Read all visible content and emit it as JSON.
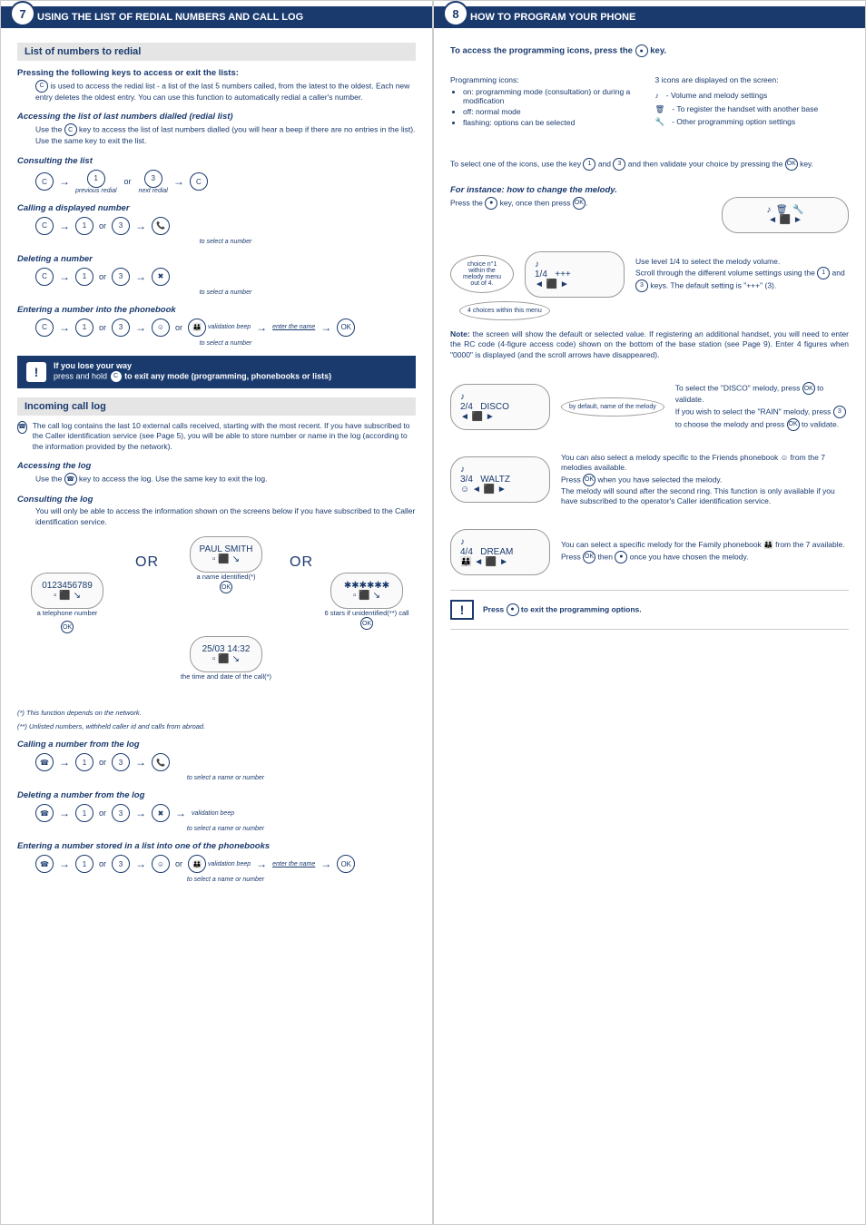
{
  "left": {
    "pageNum": "7",
    "title": "USING THE LIST OF REDIAL NUMBERS AND CALL LOG",
    "sec1": "List of numbers to redial",
    "h1": "Pressing the following keys to access or exit the lists:",
    "p1": "is used to access the redial list - a list of the last 5 numbers called, from the latest to the oldest. Each new entry deletes the oldest entry. You can use this function to automatically redial a caller's number.",
    "h2": "Accessing the list of last numbers dialled (redial list)",
    "p2a": "Use the ",
    "p2b": " key to access the list of last numbers dialled (you will hear a beep if there are no entries in the list).",
    "p2c": "Use the same key to exit the list.",
    "h3": "Consulting the list",
    "prev": "previous redial",
    "next": "next redial",
    "h4": "Calling a displayed number",
    "selnum": "to select a number",
    "h5": "Deleting a number",
    "h6": "Entering a number into the phonebook",
    "valbeep": "validation beep",
    "entername": "enter the name",
    "warn1a": "If you lose your way",
    "warn1b": "press and hold",
    "warn1c": "to exit any mode (programming, phonebooks or lists)",
    "sec2": "Incoming call log",
    "p3": "The call log contains the last 10 external calls received, starting with the most recent. If you have subscribed to the Caller identification service (see Page 5), you will be able to store number or name in the log (according to the information provided by the network).",
    "h7": "Accessing the log",
    "p4": "key to access the log. Use the same key to exit the log.",
    "p4pre": "Use the ",
    "h8": "Consulting the log",
    "p5": "You will only be able to access the information shown on the screens below if you have subscribed to the Caller identification service.",
    "or": "OR",
    "capTel": "a telephone number",
    "capName": "a name identified(*)",
    "capStars": "6 stars if unidentified(**) call",
    "capTime": "the time and date of the call(*)",
    "foot1": "(*) This function depends on the network.",
    "foot2": "(**) Unlisted numbers, withheld caller id and calls from abroad.",
    "h9": "Calling a number from the log",
    "selname": "to select a name or number",
    "h10": "Deleting a number from the log",
    "h11": "Entering a number stored in a list into one of the phonebooks"
  },
  "right": {
    "pageNum": "8",
    "title": "HOW TO PROGRAM YOUR PHONE",
    "h1": "To access the programming icons, press the ",
    "h1b": " key.",
    "pIcons": "Programming icons:",
    "li1": "on: programming mode (consultation) or during a modification",
    "li2": "off: normal mode",
    "li3": "flashing: options can be selected",
    "p3icons": "3 icons are displayed on the screen:",
    "i1": "- Volume and melody settings",
    "i2": "- To register the handset with another base",
    "i3": "- Other programming option settings",
    "pSelect": "To select one of the icons, use the key ",
    "pSelect2": " and ",
    "pSelect3": " and then validate your choice by pressing the ",
    "pSelect4": " key.",
    "hMelody": "For instance: how to change the melody.",
    "pPress": "Press the ",
    "pPress2": " key, once then press ",
    "bub1": "choice n°1 within the melody menu out of 4.",
    "bub2": "4 choices within this menu",
    "pLevel": "Use level 1/4 to select the melody volume.",
    "pScroll": "Scroll through the different volume settings using the ",
    "pScroll2": " keys. The default setting is \"+++\" (3).",
    "noteLabel": "Note:",
    "note": " the screen will show the default or selected value. If registering an additional handset, you will need to enter the RC code (4-figure access code) shown on the bottom of the base station (see Page 9). Enter 4 figures when \"0000\" is displayed (and the scroll arrows have disappeared).",
    "bubDef": "by default, name of the melody",
    "pDisco1": "To select the \"DISCO\" melody, press ",
    "pDisco2": " to validate.",
    "pRain1": "If you wish to select the \"RAIN\" melody, press ",
    "pRain2": " to choose the melody and press ",
    "pRain3": " to validate.",
    "pFriends1": "You can also select a melody specific to the Friends phonebook ",
    "pFriends2": " from the 7 melodies available.",
    "pFriends3": "Press ",
    "pFriends4": " when you have selected the melody.",
    "pFriends5": "The melody will sound after the second ring. This function is only available if you have subscribed to the operator's Caller identification service.",
    "pFamily1": "You can select a specific melody for the Family phonebook ",
    "pFamily2": " from the 7 available. Press ",
    "pFamily3": " then ",
    "pFamily4": " once you have chosen the melody.",
    "warnExit": "to exit the programming options.",
    "warnPress": "Press "
  }
}
